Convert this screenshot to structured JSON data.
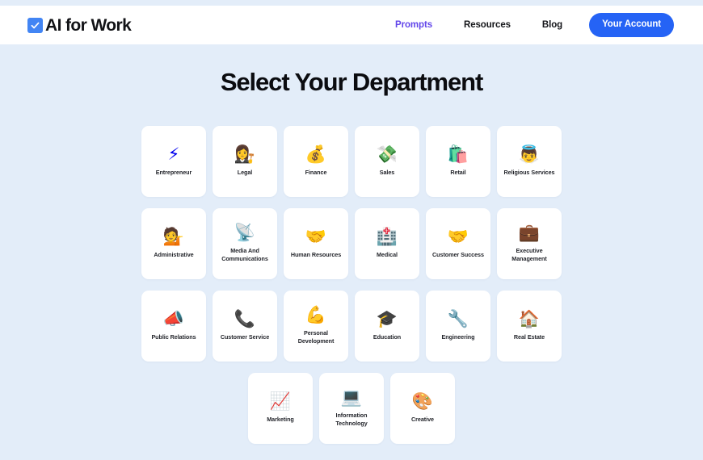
{
  "header": {
    "brand": {
      "name": "AI for Work",
      "icon": "checkbox-checked-icon",
      "icon_color": "#4285f4"
    },
    "nav": [
      {
        "label": "Prompts",
        "active": true
      },
      {
        "label": "Resources",
        "active": false
      },
      {
        "label": "Blog",
        "active": false
      }
    ],
    "account_button": {
      "label": "Your Account",
      "color": "#2563f5"
    }
  },
  "main": {
    "title": "Select Your Department",
    "background_color": "#e3edf9",
    "card_color": "#ffffff",
    "rows": [
      [
        {
          "label": "Entrepreneur",
          "icon": "⚡",
          "icon_name": "high-voltage-icon"
        },
        {
          "label": "Legal",
          "icon": "👩‍⚖️",
          "icon_name": "judge-icon"
        },
        {
          "label": "Finance",
          "icon": "💰",
          "icon_name": "money-bag-icon"
        },
        {
          "label": "Sales",
          "icon": "💸",
          "icon_name": "money-with-wings-icon"
        },
        {
          "label": "Retail",
          "icon": "🛍️",
          "icon_name": "shopping-bags-icon"
        },
        {
          "label": "Religious Services",
          "icon": "👼",
          "icon_name": "baby-angel-icon"
        }
      ],
      [
        {
          "label": "Administrative",
          "icon": "💁",
          "icon_name": "person-tipping-hand-icon"
        },
        {
          "label": "Media And Communications",
          "icon": "📡",
          "icon_name": "satellite-antenna-icon"
        },
        {
          "label": "Human Resources",
          "icon": "🤝",
          "icon_name": "handshake-icon"
        },
        {
          "label": "Medical",
          "icon": "🏥",
          "icon_name": "hospital-icon"
        },
        {
          "label": "Customer Success",
          "icon": "🤝",
          "icon_name": "handshake-yellow-icon"
        },
        {
          "label": "Executive Management",
          "icon": "💼",
          "icon_name": "briefcase-icon"
        }
      ],
      [
        {
          "label": "Public Relations",
          "icon": "📣",
          "icon_name": "megaphone-icon"
        },
        {
          "label": "Customer Service",
          "icon": "📞",
          "icon_name": "telephone-receiver-icon"
        },
        {
          "label": "Personal Development",
          "icon": "💪",
          "icon_name": "flexed-biceps-icon"
        },
        {
          "label": "Education",
          "icon": "🎓",
          "icon_name": "graduation-cap-icon"
        },
        {
          "label": "Engineering",
          "icon": "🔧",
          "icon_name": "wrench-icon"
        },
        {
          "label": "Real Estate",
          "icon": "🏠",
          "icon_name": "house-icon"
        }
      ],
      [
        {
          "label": "Marketing",
          "icon": "📈",
          "icon_name": "chart-increasing-icon"
        },
        {
          "label": "Information Technology",
          "icon": "💻",
          "icon_name": "laptop-icon"
        },
        {
          "label": "Creative",
          "icon": "🎨",
          "icon_name": "artist-palette-icon"
        }
      ]
    ]
  }
}
